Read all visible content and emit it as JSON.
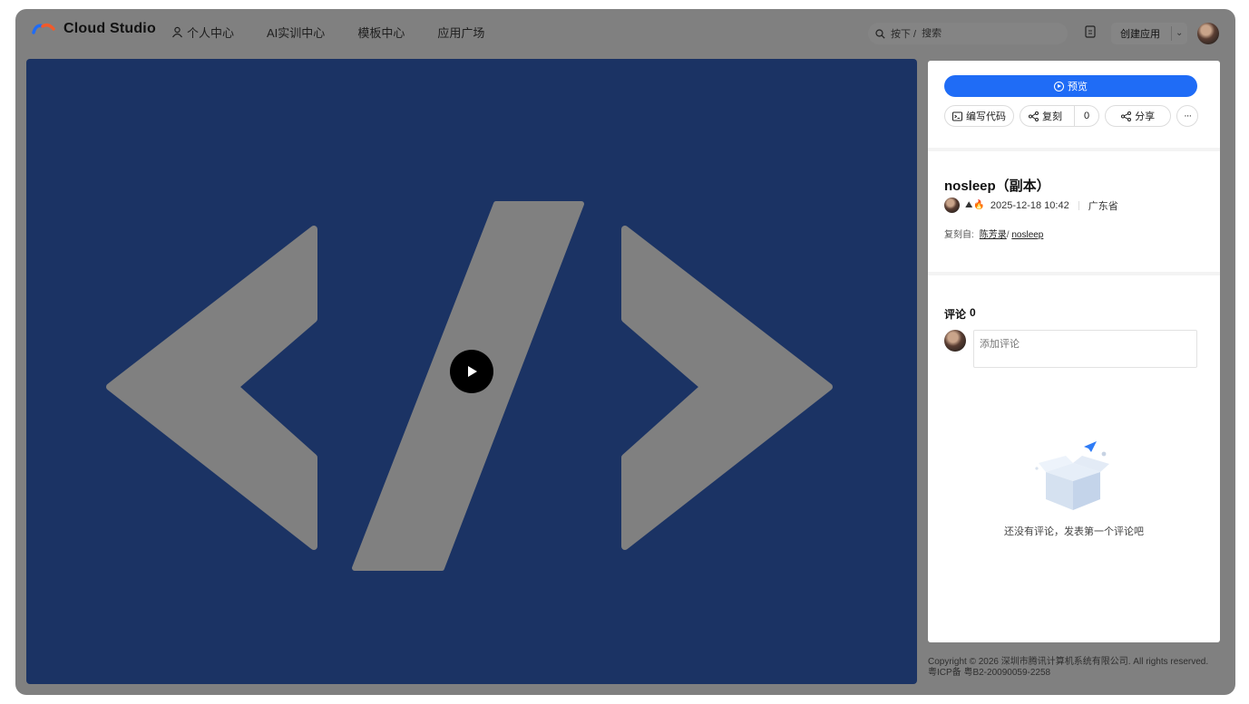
{
  "app": {
    "name": "Cloud Studio"
  },
  "nav": [
    {
      "label": "个人中心",
      "icon": "user-icon"
    },
    {
      "label": "AI实训中心"
    },
    {
      "label": "模板中心"
    },
    {
      "label": "应用广场"
    }
  ],
  "search": {
    "prefix": "按下 /",
    "placeholder": "搜索"
  },
  "header": {
    "create_label": "创建应用"
  },
  "panel": {
    "preview_label": "预览",
    "write_code_label": "编写代码",
    "copy_label": "复刻",
    "copy_count": "0",
    "share_label": "分享",
    "more_label": "···"
  },
  "project": {
    "title": "nosleep（副本）",
    "badges": [
      "⛰",
      "🔥"
    ],
    "date": "2025-12-18 10:42",
    "location": "广东省",
    "copied_from_label": "复刻自:",
    "copied_from_author": "陈芳录",
    "copied_from_separator": "/",
    "copied_from_project": "nosleep"
  },
  "comments": {
    "title": "评论",
    "count": "0",
    "placeholder": "添加评论",
    "empty_text": "还没有评论，发表第一个评论吧"
  },
  "footer": {
    "copyright": "Copyright © 2026 深圳市腾讯计算机系统有限公司. All rights reserved.",
    "icp": "粤ICP备 粤B2-20090059-2258"
  },
  "colors": {
    "accent": "#1f6cf6",
    "preview_bg": "#1b3364",
    "overlay": "#808080"
  }
}
